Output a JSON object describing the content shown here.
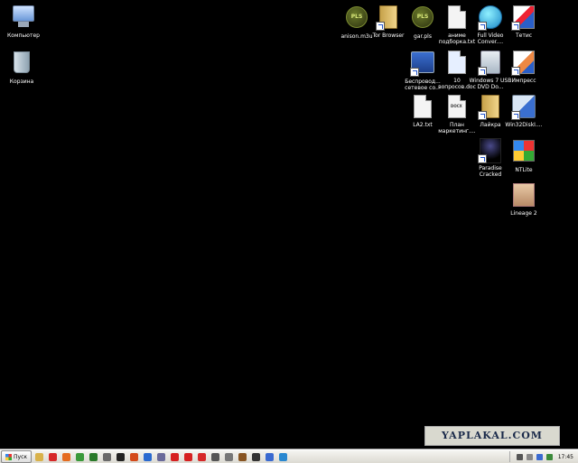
{
  "desktop": {
    "icons": [
      {
        "label": "Компьютер",
        "icon": "computer-icon"
      },
      {
        "label": "Корзина",
        "icon": "recycle-bin-icon"
      },
      {
        "label": "anison.m3u",
        "icon": "playlist-icon"
      },
      {
        "label": "Tor Browser",
        "icon": "tor-browser-icon"
      },
      {
        "label": "gar.pls",
        "icon": "playlist-icon"
      },
      {
        "label": "аниме подборка.txt",
        "icon": "text-file-icon"
      },
      {
        "label": "Full Video Conver....",
        "icon": "video-converter-icon"
      },
      {
        "label": "Тетис",
        "icon": "tetris-icon"
      },
      {
        "label": "Беспровод... сетевое со...",
        "icon": "network-connection-icon"
      },
      {
        "label": "10 вопросов.doc",
        "icon": "doc-file-icon"
      },
      {
        "label": "Windows 7 USB DVD Do...",
        "icon": "usb-dvd-tool-icon"
      },
      {
        "label": "Импресс",
        "icon": "impress-icon"
      },
      {
        "label": "LA2.txt",
        "icon": "text-file-icon"
      },
      {
        "label": "План маркетинг....",
        "icon": "docx-file-icon"
      },
      {
        "label": "Лайкра",
        "icon": "folder-icon"
      },
      {
        "label": "Win32DiskI....",
        "icon": "disk-imager-icon"
      },
      {
        "label": "Paradise Cracked",
        "icon": "game-icon"
      },
      {
        "label": "NTLite",
        "icon": "ntlite-icon"
      },
      {
        "label": "Lineage 2",
        "icon": "game-icon"
      }
    ]
  },
  "watermark": {
    "text": "YAPLAKAL.COM"
  },
  "taskbar": {
    "start_label": "Пуск",
    "clock": "17:45",
    "quick_launch": [
      {
        "name": "explorer-icon",
        "color": "#d9b24a"
      },
      {
        "name": "opera-icon",
        "color": "#d62828"
      },
      {
        "name": "firefox-icon",
        "color": "#e56b1f"
      },
      {
        "name": "chrome-icon",
        "color": "#3a9a3a"
      },
      {
        "name": "media-icon",
        "color": "#2a7a2a"
      },
      {
        "name": "torrent-icon",
        "color": "#6a6a6a"
      },
      {
        "name": "app-icon",
        "color": "#222222"
      },
      {
        "name": "app-icon",
        "color": "#d44a1a"
      },
      {
        "name": "app-icon",
        "color": "#2a6ad0"
      },
      {
        "name": "app-icon",
        "color": "#6a6a9a"
      },
      {
        "name": "youtube-icon",
        "color": "#d62020"
      },
      {
        "name": "app-icon",
        "color": "#d62020"
      },
      {
        "name": "vivaldi-icon",
        "color": "#d62828"
      },
      {
        "name": "app-icon",
        "color": "#555555"
      },
      {
        "name": "app-icon",
        "color": "#777777"
      },
      {
        "name": "app-icon",
        "color": "#885522"
      },
      {
        "name": "app-icon",
        "color": "#333333"
      },
      {
        "name": "app-icon",
        "color": "#3a6ad0"
      },
      {
        "name": "help-icon",
        "color": "#2a88d0"
      }
    ],
    "tray": [
      {
        "name": "tray-icon",
        "color": "#555555"
      },
      {
        "name": "tray-icon",
        "color": "#888888"
      },
      {
        "name": "volume-icon",
        "color": "#3a6ad0"
      },
      {
        "name": "network-icon",
        "color": "#3a8a3a"
      }
    ]
  }
}
